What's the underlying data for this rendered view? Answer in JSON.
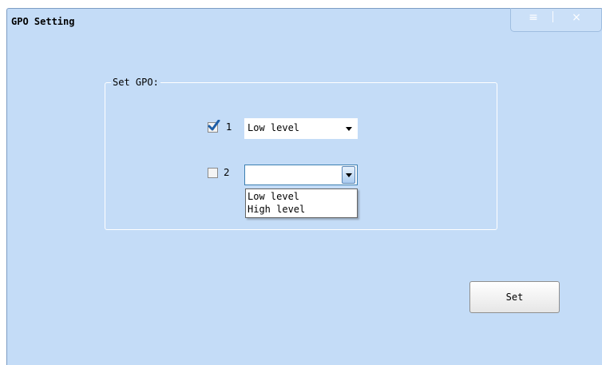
{
  "window": {
    "title": "GPO Setting"
  },
  "window_controls": {
    "menu_icon": "menu-icon",
    "close_icon": "close-icon",
    "menu_glyph": "≡",
    "close_glyph": "×"
  },
  "group": {
    "legend": "Set GPO:"
  },
  "gpo": [
    {
      "label": "1",
      "checked": true,
      "selected": "Low level"
    },
    {
      "label": "2",
      "checked": false,
      "selected": ""
    }
  ],
  "dropdown": {
    "options": [
      "Low level",
      "High level"
    ]
  },
  "actions": {
    "set_label": "Set"
  },
  "colors": {
    "window_bg": "#c4dcf7",
    "frame_line": "#ffffff",
    "check_mark": "#1e5fa8"
  }
}
